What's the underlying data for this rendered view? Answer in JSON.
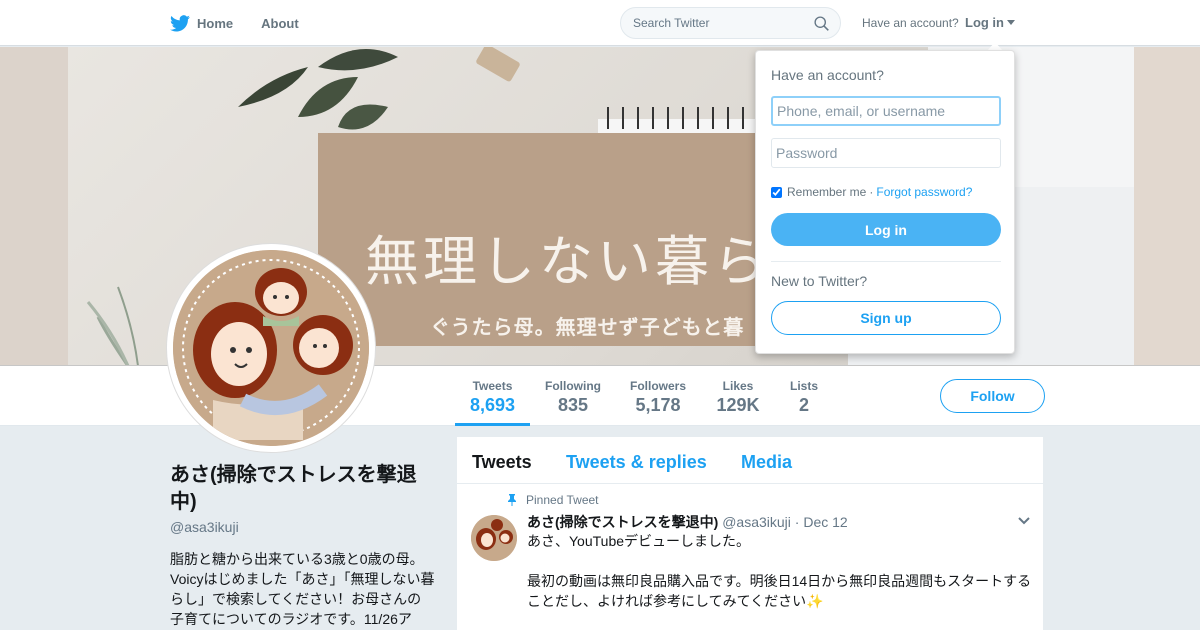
{
  "nav": {
    "home_label": "Home",
    "about_label": "About",
    "search_placeholder": "Search Twitter",
    "have_account_text": "Have an account?",
    "login_label": "Log in"
  },
  "banner": {
    "title": "無理しない暮ら",
    "subtitle": "ぐうたら母。無理せず子どもと暮"
  },
  "stats": [
    {
      "label": "Tweets",
      "value": "8,693",
      "active": true
    },
    {
      "label": "Following",
      "value": "835"
    },
    {
      "label": "Followers",
      "value": "5,178"
    },
    {
      "label": "Likes",
      "value": "129K"
    },
    {
      "label": "Lists",
      "value": "2"
    }
  ],
  "follow_label": "Follow",
  "profile": {
    "name": "あさ(掃除でストレスを撃退中)",
    "handle": "@asa3ikuji",
    "bio": "脂肪と糖から出来ている3歳と0歳の母。Voicyはじめました「あさ」「無理しない暮らし」で検索してください！お母さんの子育てについてのラジオです。11/26ア"
  },
  "timeline": {
    "tabs": [
      "Tweets",
      "Tweets & replies",
      "Media"
    ],
    "pinned_label": "Pinned Tweet",
    "tweet": {
      "name": "あさ(掃除でストレスを撃退中)",
      "handle": "@asa3ikuji",
      "separator": "·",
      "date": "Dec 12",
      "line1": "あさ、YouTubeデビューしました。",
      "line2": "最初の動画は無印良品購入品です。明後日14日から無印良品週間もスタートすることだし、よければ参考にしてみてください✨"
    }
  },
  "login_dropdown": {
    "title": "Have an account?",
    "username_placeholder": "Phone, email, or username",
    "password_placeholder": "Password",
    "remember_label": "Remember me",
    "separator": "·",
    "forgot_label": "Forgot password?",
    "login_button": "Log in",
    "new_label": "New to Twitter?",
    "signup_button": "Sign up"
  },
  "colors": {
    "accent": "#1da1f2",
    "login_button": "#4ab3f4",
    "background": "#e6ecf0"
  }
}
